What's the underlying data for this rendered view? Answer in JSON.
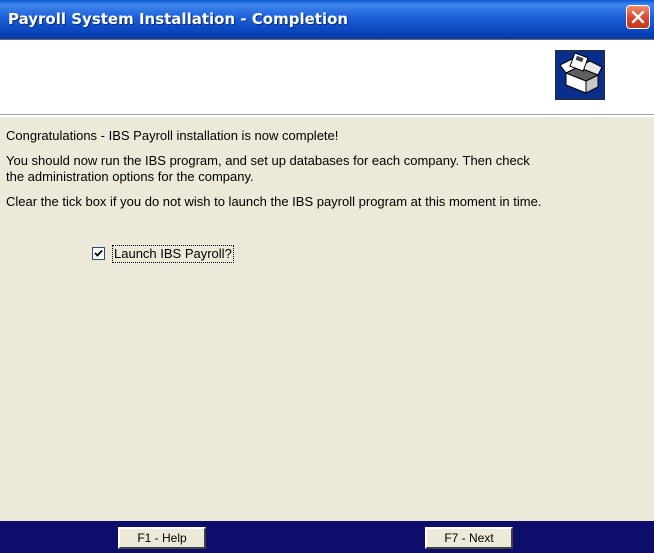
{
  "window": {
    "title": "Payroll System Installation - Completion",
    "close_icon": "close-icon"
  },
  "header": {
    "icon": "install-box-icon"
  },
  "content": {
    "line1": "Congratulations - IBS Payroll installation is now complete!",
    "line2a": "You should now run the IBS program, and set up databases for each company.  Then check",
    "line2b": "the administration options for the company.",
    "line3": "Clear the tick box if you do not wish to launch the IBS payroll program at this moment in time."
  },
  "launch_checkbox": {
    "label": "Launch IBS Payroll?",
    "checked": true
  },
  "buttons": {
    "help": "F1 - Help",
    "next": "F7 - Next"
  },
  "colors": {
    "title_bar": "#0842b8",
    "bottom_bar": "#0d0d6b",
    "dialog_bg": "#ece9d8",
    "close_button": "#d8462a"
  }
}
